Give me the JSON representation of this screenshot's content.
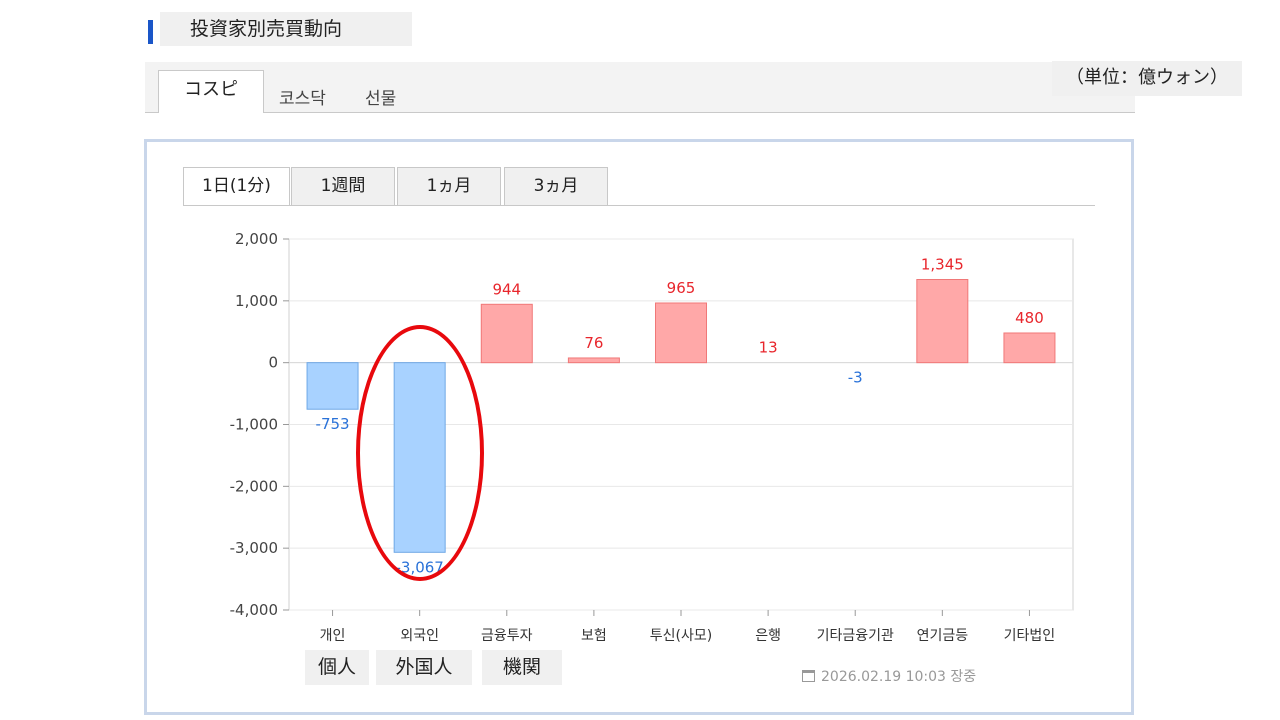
{
  "header": {
    "title": "投資家別売買動向"
  },
  "market_tabs": [
    "コスピ",
    "코스닥",
    "선물"
  ],
  "unit_label": "（単位：億ウォン）",
  "period_tabs": [
    "1日(1分)",
    "1週間",
    "1ヵ月",
    "3ヵ月"
  ],
  "jp_labels": [
    "個人",
    "外国人",
    "機関"
  ],
  "timestamp": "2026.02.19 10:03 장중",
  "chart_data": {
    "type": "bar",
    "categories": [
      "개인",
      "외국인",
      "금융투자",
      "보험",
      "투신(사모)",
      "은행",
      "기타금융기관",
      "연기금등",
      "기타법인"
    ],
    "values": [
      -753,
      -3067,
      944,
      76,
      965,
      13,
      -3,
      1345,
      480
    ],
    "value_labels": [
      "-753",
      "-3,067",
      "944",
      "76",
      "965",
      "13",
      "-3",
      "1,345",
      "480"
    ],
    "ylim": [
      -4000,
      2000
    ],
    "yticks": [
      2000,
      1000,
      0,
      -1000,
      -2000,
      -3000,
      -4000
    ],
    "ytick_labels": [
      "2,000",
      "1,000",
      "0",
      "-1,000",
      "-2,000",
      "-3,000",
      "-4,000"
    ],
    "colors": {
      "positive_fill": "#ffa8a8",
      "positive_stroke": "#f07878",
      "positive_text": "#e8262c",
      "negative_fill": "#a8d2ff",
      "negative_stroke": "#6fa8e6",
      "negative_text": "#2a72d8"
    },
    "grid": true
  }
}
